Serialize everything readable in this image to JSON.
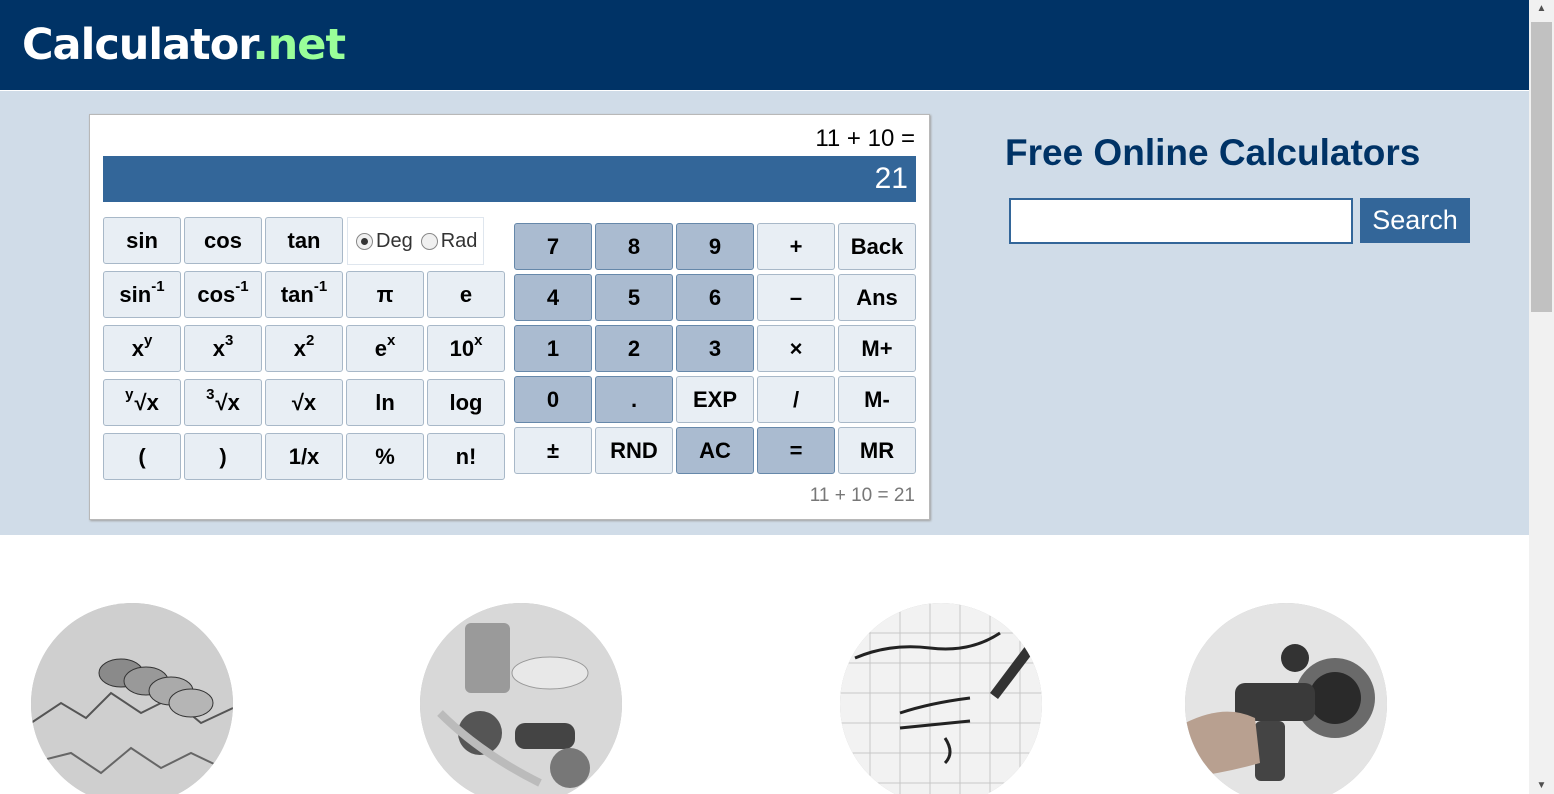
{
  "header": {
    "logo_main": "Calculator",
    "logo_tld": ".net"
  },
  "calculator": {
    "expression": "11 + 10 =",
    "display_value": "21",
    "history": "11 + 10 = 21",
    "angle_mode": {
      "deg_label": "Deg",
      "rad_label": "Rad",
      "selected": "Deg"
    },
    "sci_buttons": {
      "sin": "sin",
      "cos": "cos",
      "tan": "tan",
      "asin": "sin",
      "acos": "cos",
      "atan": "tan",
      "inv_exp": "-1",
      "pi": "π",
      "e": "e",
      "xy_base": "x",
      "xy_exp": "y",
      "x3_base": "x",
      "x3_exp": "3",
      "x2_base": "x",
      "x2_exp": "2",
      "ex_base": "e",
      "ex_exp": "x",
      "tenx_base": "10",
      "tenx_exp": "x",
      "yroot_pre": "y",
      "yroot_main": "√x",
      "croot_pre": "3",
      "croot_main": "√x",
      "sqrt": "√x",
      "ln": "ln",
      "log": "log",
      "lparen": "(",
      "rparen": ")",
      "recip": "1/x",
      "percent": "%",
      "fact": "n!"
    },
    "num_buttons": {
      "n7": "7",
      "n8": "8",
      "n9": "9",
      "plus": "+",
      "back": "Back",
      "n4": "4",
      "n5": "5",
      "n6": "6",
      "minus": "–",
      "ans": "Ans",
      "n1": "1",
      "n2": "2",
      "n3": "3",
      "times": "×",
      "mplus": "M+",
      "n0": "0",
      "dot": ".",
      "exp": "EXP",
      "divide": "/",
      "mminus": "M-",
      "plusminus": "±",
      "rnd": "RND",
      "ac": "AC",
      "equals": "=",
      "mr": "MR"
    }
  },
  "search": {
    "title": "Free Online Calculators",
    "button_label": "Search",
    "input_value": ""
  },
  "categories": [
    {
      "icon": "coins-chart-photo"
    },
    {
      "icon": "fitness-food-photo"
    },
    {
      "icon": "math-paper-photo"
    },
    {
      "icon": "fuel-pump-photo"
    }
  ],
  "scrollbar": {
    "up_arrow": "▲",
    "down_arrow": "▼"
  }
}
